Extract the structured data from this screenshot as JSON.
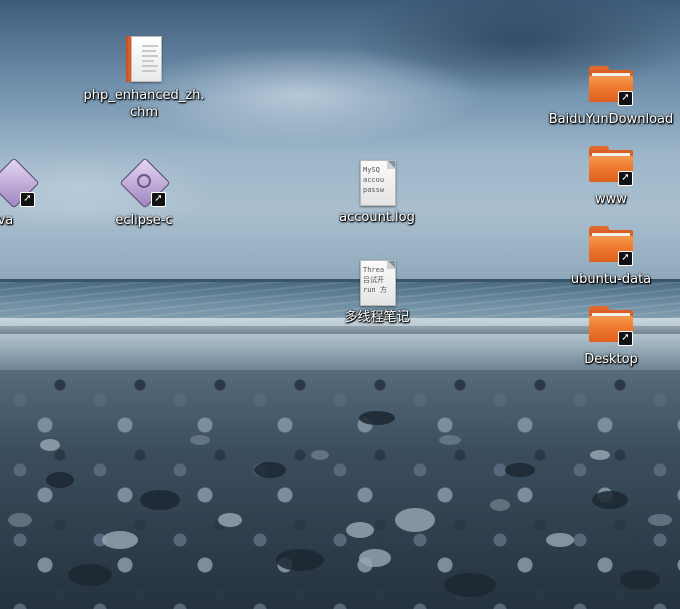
{
  "desktop": {
    "icons": [
      {
        "label": "php_enhanced_zh.\nchm",
        "type": "chm-file"
      },
      {
        "label": "java",
        "type": "application-link"
      },
      {
        "label": "eclipse-c",
        "type": "application-link"
      },
      {
        "label": "account.log",
        "type": "text-file",
        "preview": [
          "MySQ",
          "accou",
          "passw"
        ]
      },
      {
        "label": "多线程笔记",
        "type": "text-file",
        "preview": [
          "Threa",
          "吕试开",
          "run 方"
        ]
      },
      {
        "label": "BaiduYunDownload",
        "type": "folder-link"
      },
      {
        "label": "www",
        "type": "folder-link"
      },
      {
        "label": "ubuntu-data",
        "type": "folder-link"
      },
      {
        "label": "Desktop",
        "type": "folder-link"
      }
    ],
    "colors": {
      "folder_orange": "#ef7a2f",
      "label_text": "#ffffff"
    }
  }
}
